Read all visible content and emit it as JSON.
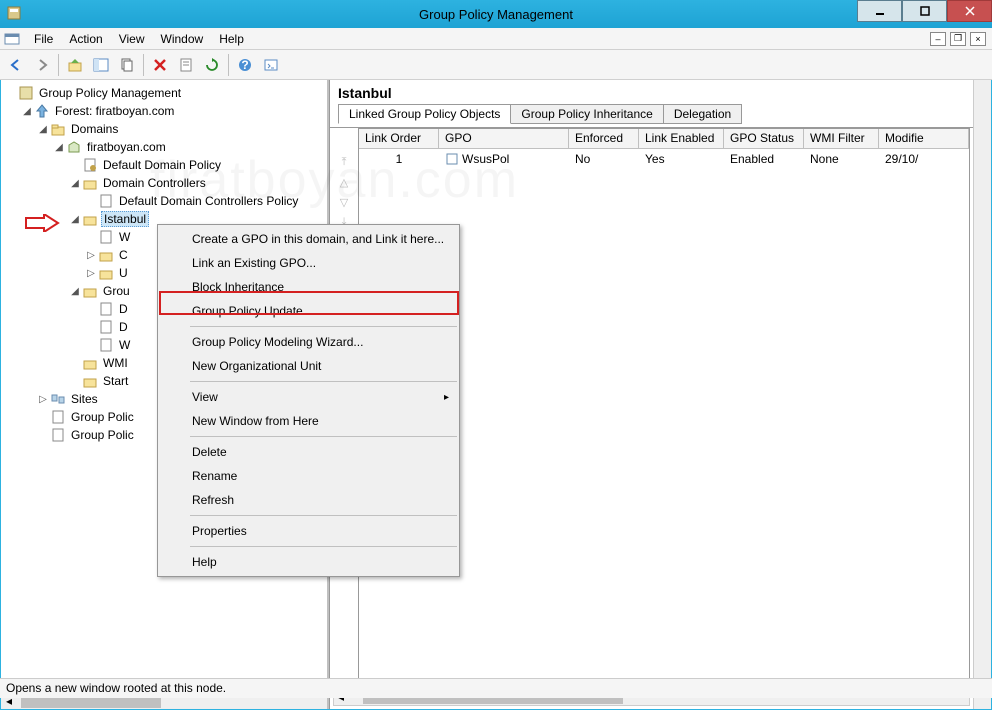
{
  "window": {
    "title": "Group Policy Management"
  },
  "menubar": {
    "items": [
      "File",
      "Action",
      "View",
      "Window",
      "Help"
    ]
  },
  "tree": {
    "root": "Group Policy Management",
    "forest": "Forest: firatboyan.com",
    "domains": "Domains",
    "domain": "firatboyan.com",
    "ddp": "Default Domain Policy",
    "dc": "Domain Controllers",
    "ddcp": "Default Domain Controllers Policy",
    "istanbul": "Istanbul",
    "w1": "W",
    "c": "C",
    "u": "U",
    "group": "Grou",
    "d1": "D",
    "d2": "D",
    "w2": "W",
    "wmi": "WMI",
    "start": "Start",
    "sites": "Sites",
    "gp1": "Group Polic",
    "gp2": "Group Polic"
  },
  "right": {
    "title": "Istanbul",
    "tabs": [
      "Linked Group Policy Objects",
      "Group Policy Inheritance",
      "Delegation"
    ],
    "columns": [
      "Link Order",
      "GPO",
      "Enforced",
      "Link Enabled",
      "GPO Status",
      "WMI Filter",
      "Modifie"
    ],
    "row": {
      "order": "1",
      "gpo": "WsusPol",
      "enforced": "No",
      "linkEnabled": "Yes",
      "status": "Enabled",
      "wmi": "None",
      "modified": "29/10/"
    }
  },
  "ctx": {
    "items": [
      "Create a GPO in this domain, and Link it here...",
      "Link an Existing GPO...",
      "Block Inheritance",
      "Group Policy Update...",
      "Group Policy Modeling Wizard...",
      "New Organizational Unit",
      "View",
      "New Window from Here",
      "Delete",
      "Rename",
      "Refresh",
      "Properties",
      "Help"
    ]
  },
  "status": "Opens a new window rooted at this node."
}
